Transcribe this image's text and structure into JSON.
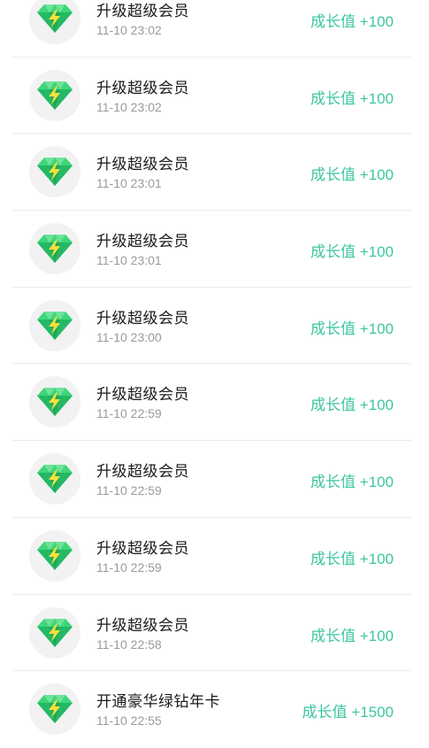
{
  "records": [
    {
      "title": "升级超级会员",
      "time": "11-10 23:02",
      "growth": "成长值 +100",
      "icon": "green-diamond-lightning-icon"
    },
    {
      "title": "升级超级会员",
      "time": "11-10 23:02",
      "growth": "成长值 +100",
      "icon": "green-diamond-lightning-icon"
    },
    {
      "title": "升级超级会员",
      "time": "11-10 23:01",
      "growth": "成长值 +100",
      "icon": "green-diamond-lightning-icon"
    },
    {
      "title": "升级超级会员",
      "time": "11-10 23:01",
      "growth": "成长值 +100",
      "icon": "green-diamond-lightning-icon"
    },
    {
      "title": "升级超级会员",
      "time": "11-10 23:00",
      "growth": "成长值 +100",
      "icon": "green-diamond-lightning-icon"
    },
    {
      "title": "升级超级会员",
      "time": "11-10 22:59",
      "growth": "成长值 +100",
      "icon": "green-diamond-lightning-icon"
    },
    {
      "title": "升级超级会员",
      "time": "11-10 22:59",
      "growth": "成长值 +100",
      "icon": "green-diamond-lightning-icon"
    },
    {
      "title": "升级超级会员",
      "time": "11-10 22:59",
      "growth": "成长值 +100",
      "icon": "green-diamond-lightning-icon"
    },
    {
      "title": "升级超级会员",
      "time": "11-10 22:58",
      "growth": "成长值 +100",
      "icon": "green-diamond-lightning-icon"
    },
    {
      "title": "开通豪华绿钻年卡",
      "time": "11-10 22:55",
      "growth": "成长值 +1500",
      "icon": "green-diamond-lightning-icon"
    }
  ],
  "colors": {
    "growth_text": "#3cc6a0",
    "title_text": "#1a1a1a",
    "time_text": "#9a9a9a",
    "avatar_bg": "#f2f2f2",
    "diamond_light": "#3fd67a",
    "diamond_dark": "#1fa85a",
    "bolt": "#f6e23a"
  }
}
